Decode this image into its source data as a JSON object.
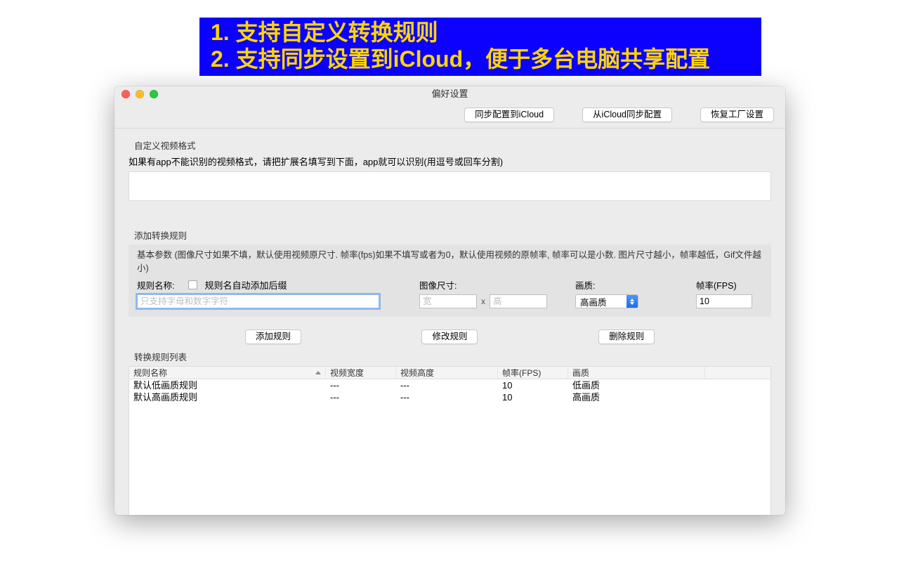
{
  "banner": {
    "line1": "1. 支持自定义转换规则",
    "line2": "2. 支持同步设置到iCloud，便于多台电脑共享配置"
  },
  "window": {
    "title": "偏好设置",
    "toolbar": {
      "sync_to": "同步配置到iCloud",
      "sync_from": "从iCloud同步配置",
      "restore": "恢复工厂设置"
    },
    "custom_format": {
      "label": "自定义视频格式",
      "hint": "如果有app不能识别的视频格式，请把扩展名填写到下面，app就可以识别(用逗号或回车分割)",
      "value": ""
    },
    "add_rule": {
      "label": "添加转换规则",
      "note": "基本参数 (图像尺寸如果不填，默认使用视频原尺寸. 帧率(fps)如果不填写或者为0，默认使用视频的原帧率, 帧率可以是小数. 图片尺寸越小，帧率越低，Gif文件越小)",
      "name_label": "规则名称:",
      "name_placeholder": "只支持字母和数字字符",
      "auto_suffix_label": "规则名自动添加后缀",
      "size_label": "图像尺寸:",
      "width_placeholder": "宽",
      "height_placeholder": "高",
      "quality_label": "画质:",
      "quality_value": "高画质",
      "fps_label": "帧率(FPS)",
      "fps_value": "10"
    },
    "actions": {
      "add": "添加规则",
      "modify": "修改规则",
      "delete": "删除规则"
    },
    "table": {
      "label": "转换规则列表",
      "headers": {
        "name": "规则名称",
        "width": "视频宽度",
        "height": "视频高度",
        "fps": "帧率(FPS)",
        "quality": "画质"
      },
      "rows": [
        {
          "name": "默认低画质规则",
          "width": "---",
          "height": "---",
          "fps": "10",
          "quality": "低画质"
        },
        {
          "name": "默认高画质规则",
          "width": "---",
          "height": "---",
          "fps": "10",
          "quality": "高画质"
        }
      ]
    }
  }
}
